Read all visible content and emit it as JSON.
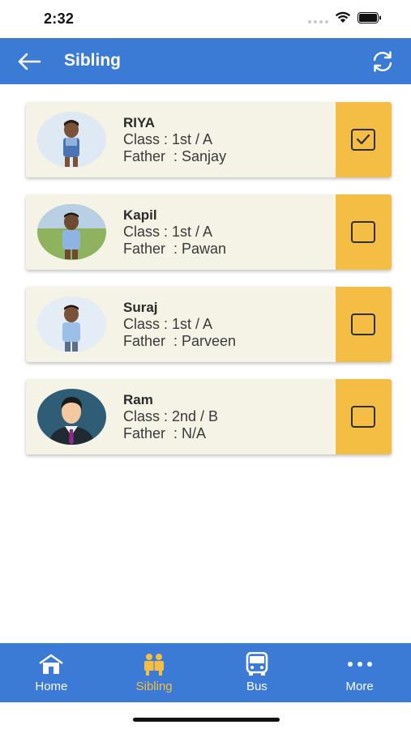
{
  "status_bar": {
    "time": "2:32"
  },
  "app_bar": {
    "title": "Sibling"
  },
  "siblings": [
    {
      "name": "RIYA",
      "class_line": "Class : 1st / A",
      "father_line": "Father  : Sanjay",
      "checked": true,
      "avatar": "child-photo"
    },
    {
      "name": "Kapil",
      "class_line": "Class : 1st / A",
      "father_line": "Father  : Pawan",
      "checked": false,
      "avatar": "child-photo"
    },
    {
      "name": "Suraj",
      "class_line": "Class : 1st / A",
      "father_line": "Father  : Parveen",
      "checked": false,
      "avatar": "child-photo"
    },
    {
      "name": "Ram",
      "class_line": "Class : 2nd / B",
      "father_line": "Father  : N/A",
      "checked": false,
      "avatar": "default-person-avatar"
    }
  ],
  "bottom_nav": [
    {
      "label": "Home",
      "icon": "home-icon",
      "active": false
    },
    {
      "label": "Sibling",
      "icon": "sibling-icon",
      "active": true
    },
    {
      "label": "Bus",
      "icon": "bus-icon",
      "active": false
    },
    {
      "label": "More",
      "icon": "more-icon",
      "active": false
    }
  ],
  "colors": {
    "primary": "#3b7bd5",
    "accent": "#f4bd43",
    "card": "#f5f2e6"
  }
}
